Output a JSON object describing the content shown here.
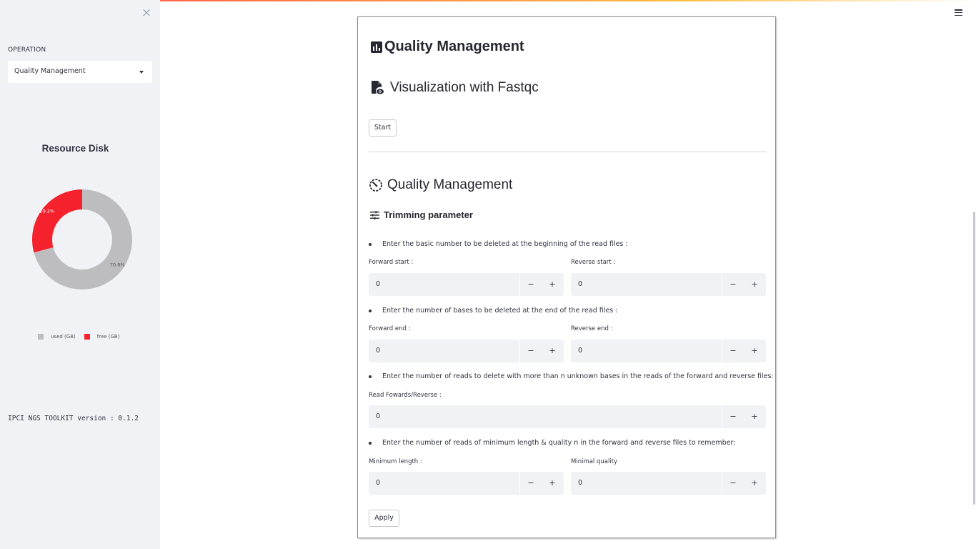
{
  "sidebar": {
    "close_glyph": "×",
    "operation_label": "OPERATION",
    "operation_selected": "Quality Management",
    "chart_title": "Resource Disk",
    "version_text": "IPCI NGS TOOLKIT version : 0.1.2"
  },
  "chart_data": {
    "type": "pie",
    "title": "Resource Disk",
    "donut": true,
    "categories": [
      "used (GB)",
      "free (GB)"
    ],
    "values": [
      70.8,
      29.2
    ],
    "labels": [
      "70.8%",
      "29.2%"
    ],
    "colors": [
      "#bdbdc0",
      "#f5222d"
    ],
    "legend_position": "bottom"
  },
  "main": {
    "title": "Quality Management",
    "fastqc_heading": "Visualization with Fastqc",
    "start_label": "Start",
    "qm_heading": "Quality Management",
    "trimming_heading": "Trimming parameter",
    "bullet1": "Enter the basic number to be deleted at the beginning of the read files :",
    "forward_start_label": "Forward start :",
    "forward_start_value": "0",
    "reverse_start_label": "Reverse start :",
    "reverse_start_value": "0",
    "bullet2": "Enter the number of bases to be deleted at the end of the read files :",
    "forward_end_label": "Forward end :",
    "forward_end_value": "0",
    "reverse_end_label": "Reverse end :",
    "reverse_end_value": "0",
    "bullet3": "Enter the number of reads to delete with more than n unknown bases in the reads of the forward and reverse files:",
    "read_fr_label": "Read Fowards/Reverse :",
    "read_fr_value": "0",
    "bullet4": "Enter the number of reads of minimum length & quality n in the forward and reverse files to remember:",
    "min_length_label": "Minimum length :",
    "min_length_value": "0",
    "min_quality_label": "Minimal quality",
    "min_quality_value": "0",
    "minus": "−",
    "plus": "+",
    "apply_label": "Apply"
  }
}
